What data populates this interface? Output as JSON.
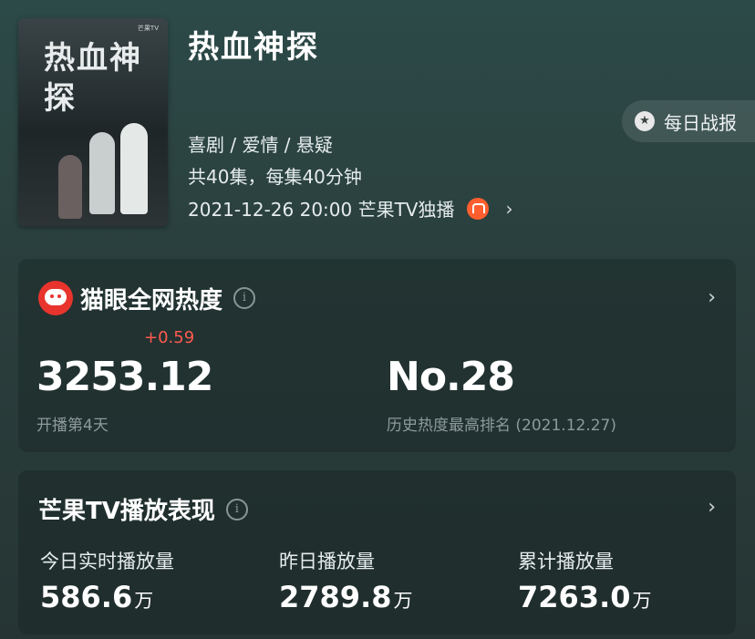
{
  "show": {
    "title": "热血神探",
    "poster_title": "热血神探",
    "poster_logo": "芒果TV",
    "genres": "喜剧 / 爱情 / 悬疑",
    "episodes": "共40集，每集40分钟",
    "airing": "2021-12-26 20:00 芒果TV独播",
    "platform_icon": "mango-tv-icon"
  },
  "daily_report": {
    "label": "每日战报",
    "icon": "medal-icon"
  },
  "heat_card": {
    "title": "猫眼全网热度",
    "icon": "maoyan-cat-icon",
    "delta": "+0.59",
    "value": "3253.12",
    "value_sub": "开播第4天",
    "rank": "No.28",
    "rank_sub": "历史热度最高排名 (2021.12.27)"
  },
  "play_card": {
    "title": "芒果TV播放表现",
    "stats": [
      {
        "label": "今日实时播放量",
        "value": "586.6",
        "unit": "万"
      },
      {
        "label": "昨日播放量",
        "value": "2789.8",
        "unit": "万"
      },
      {
        "label": "累计播放量",
        "value": "7263.0",
        "unit": "万"
      }
    ]
  },
  "colors": {
    "accent_red": "#e8342d",
    "delta_red": "#ff5a4e",
    "mango_orange": "#ff5f2e"
  }
}
